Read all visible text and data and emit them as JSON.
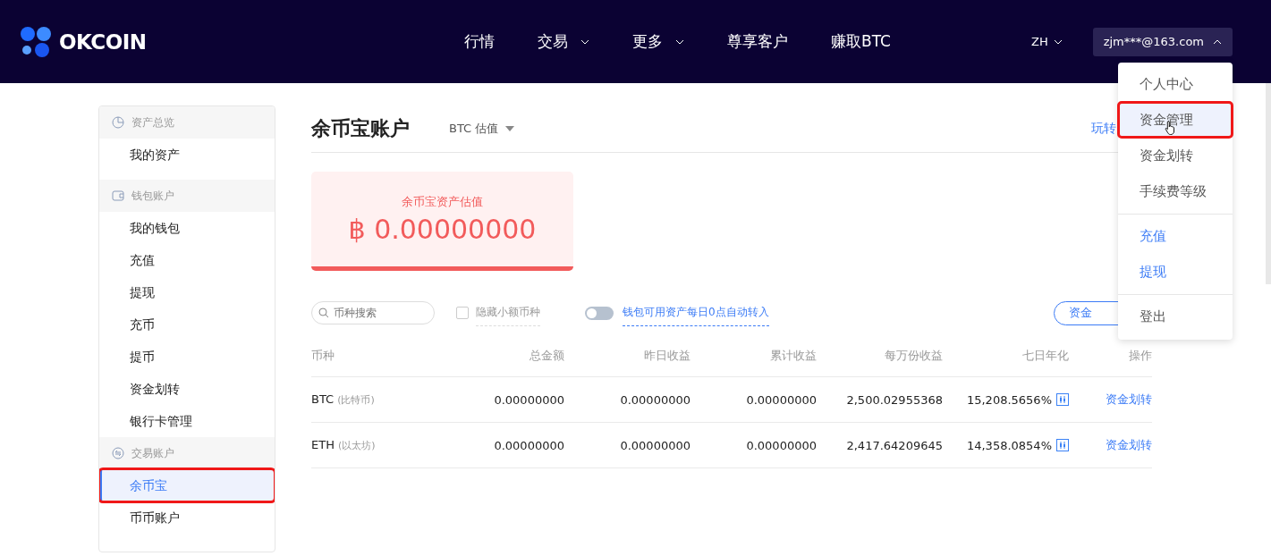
{
  "header": {
    "logo": "OKCOIN",
    "nav": [
      {
        "label": "行情",
        "dropdown": false
      },
      {
        "label": "交易",
        "dropdown": true
      },
      {
        "label": "更多",
        "dropdown": true
      },
      {
        "label": "尊享客户",
        "dropdown": false
      },
      {
        "label": "赚取BTC",
        "dropdown": false
      }
    ],
    "language": "ZH",
    "user": "zjm***@163.com",
    "user_menu_expanded": true
  },
  "sidebar": [
    {
      "title": "资产总览",
      "kind": "overview",
      "items": [
        {
          "label": "我的资产",
          "selected": false,
          "annotated": false
        }
      ]
    },
    {
      "title": "钱包账户",
      "kind": "wallet",
      "items": [
        {
          "label": "我的钱包",
          "selected": false,
          "annotated": false
        },
        {
          "label": "充值",
          "selected": false,
          "annotated": false
        },
        {
          "label": "提现",
          "selected": false,
          "annotated": false
        },
        {
          "label": "充币",
          "selected": false,
          "annotated": false
        },
        {
          "label": "提币",
          "selected": false,
          "annotated": false
        },
        {
          "label": "资金划转",
          "selected": false,
          "annotated": false
        },
        {
          "label": "银行卡管理",
          "selected": false,
          "annotated": false
        }
      ]
    },
    {
      "title": "交易账户",
      "kind": "trading",
      "items": [
        {
          "label": "余币宝",
          "selected": true,
          "annotated": true
        },
        {
          "label": "币币账户",
          "selected": false,
          "annotated": false
        }
      ]
    }
  ],
  "main": {
    "title": "余币宝账户",
    "valuation": "BTC 估值",
    "guide_link": "玩转",
    "card": {
      "label": "余币宝资产估值",
      "symbol": "฿",
      "value": "0.00000000"
    },
    "search": {
      "placeholder": "币种搜索"
    },
    "hide_small": {
      "label": "隐藏小额币种",
      "checked": false
    },
    "auto_transfer": {
      "label": "钱包可用资产每日0点自动转入",
      "on": false
    },
    "record_button": "资金"
  },
  "table": {
    "columns": [
      "币种",
      "总金额",
      "昨日收益",
      "累计收益",
      "每万份收益",
      "七日年化",
      "操作"
    ],
    "rows": [
      {
        "coin": "BTC",
        "name": "(比特币)",
        "total": "0.00000000",
        "yesterday": "0.00000000",
        "cumulative": "0.00000000",
        "per_10k": "2,500.02955368",
        "seven_day": "15,208.5656%",
        "action": "资金划转"
      },
      {
        "coin": "ETH",
        "name": "(以太坊)",
        "total": "0.00000000",
        "yesterday": "0.00000000",
        "cumulative": "0.00000000",
        "per_10k": "2,417.64209645",
        "seven_day": "14,358.0854%",
        "action": "资金划转"
      }
    ]
  },
  "user_menu": [
    [
      {
        "label": "个人中心",
        "kind": "plain",
        "hovered": false,
        "annotated": false
      },
      {
        "label": "资金管理",
        "kind": "plain",
        "hovered": true,
        "annotated": true
      },
      {
        "label": "资金划转",
        "kind": "plain",
        "hovered": false,
        "annotated": false
      },
      {
        "label": "手续费等级",
        "kind": "plain",
        "hovered": false,
        "annotated": false
      }
    ],
    [
      {
        "label": "充值",
        "kind": "link",
        "hovered": false,
        "annotated": false
      },
      {
        "label": "提现",
        "kind": "link",
        "hovered": false,
        "annotated": false
      }
    ],
    [
      {
        "label": "登出",
        "kind": "plain",
        "hovered": false,
        "annotated": false
      }
    ]
  ]
}
